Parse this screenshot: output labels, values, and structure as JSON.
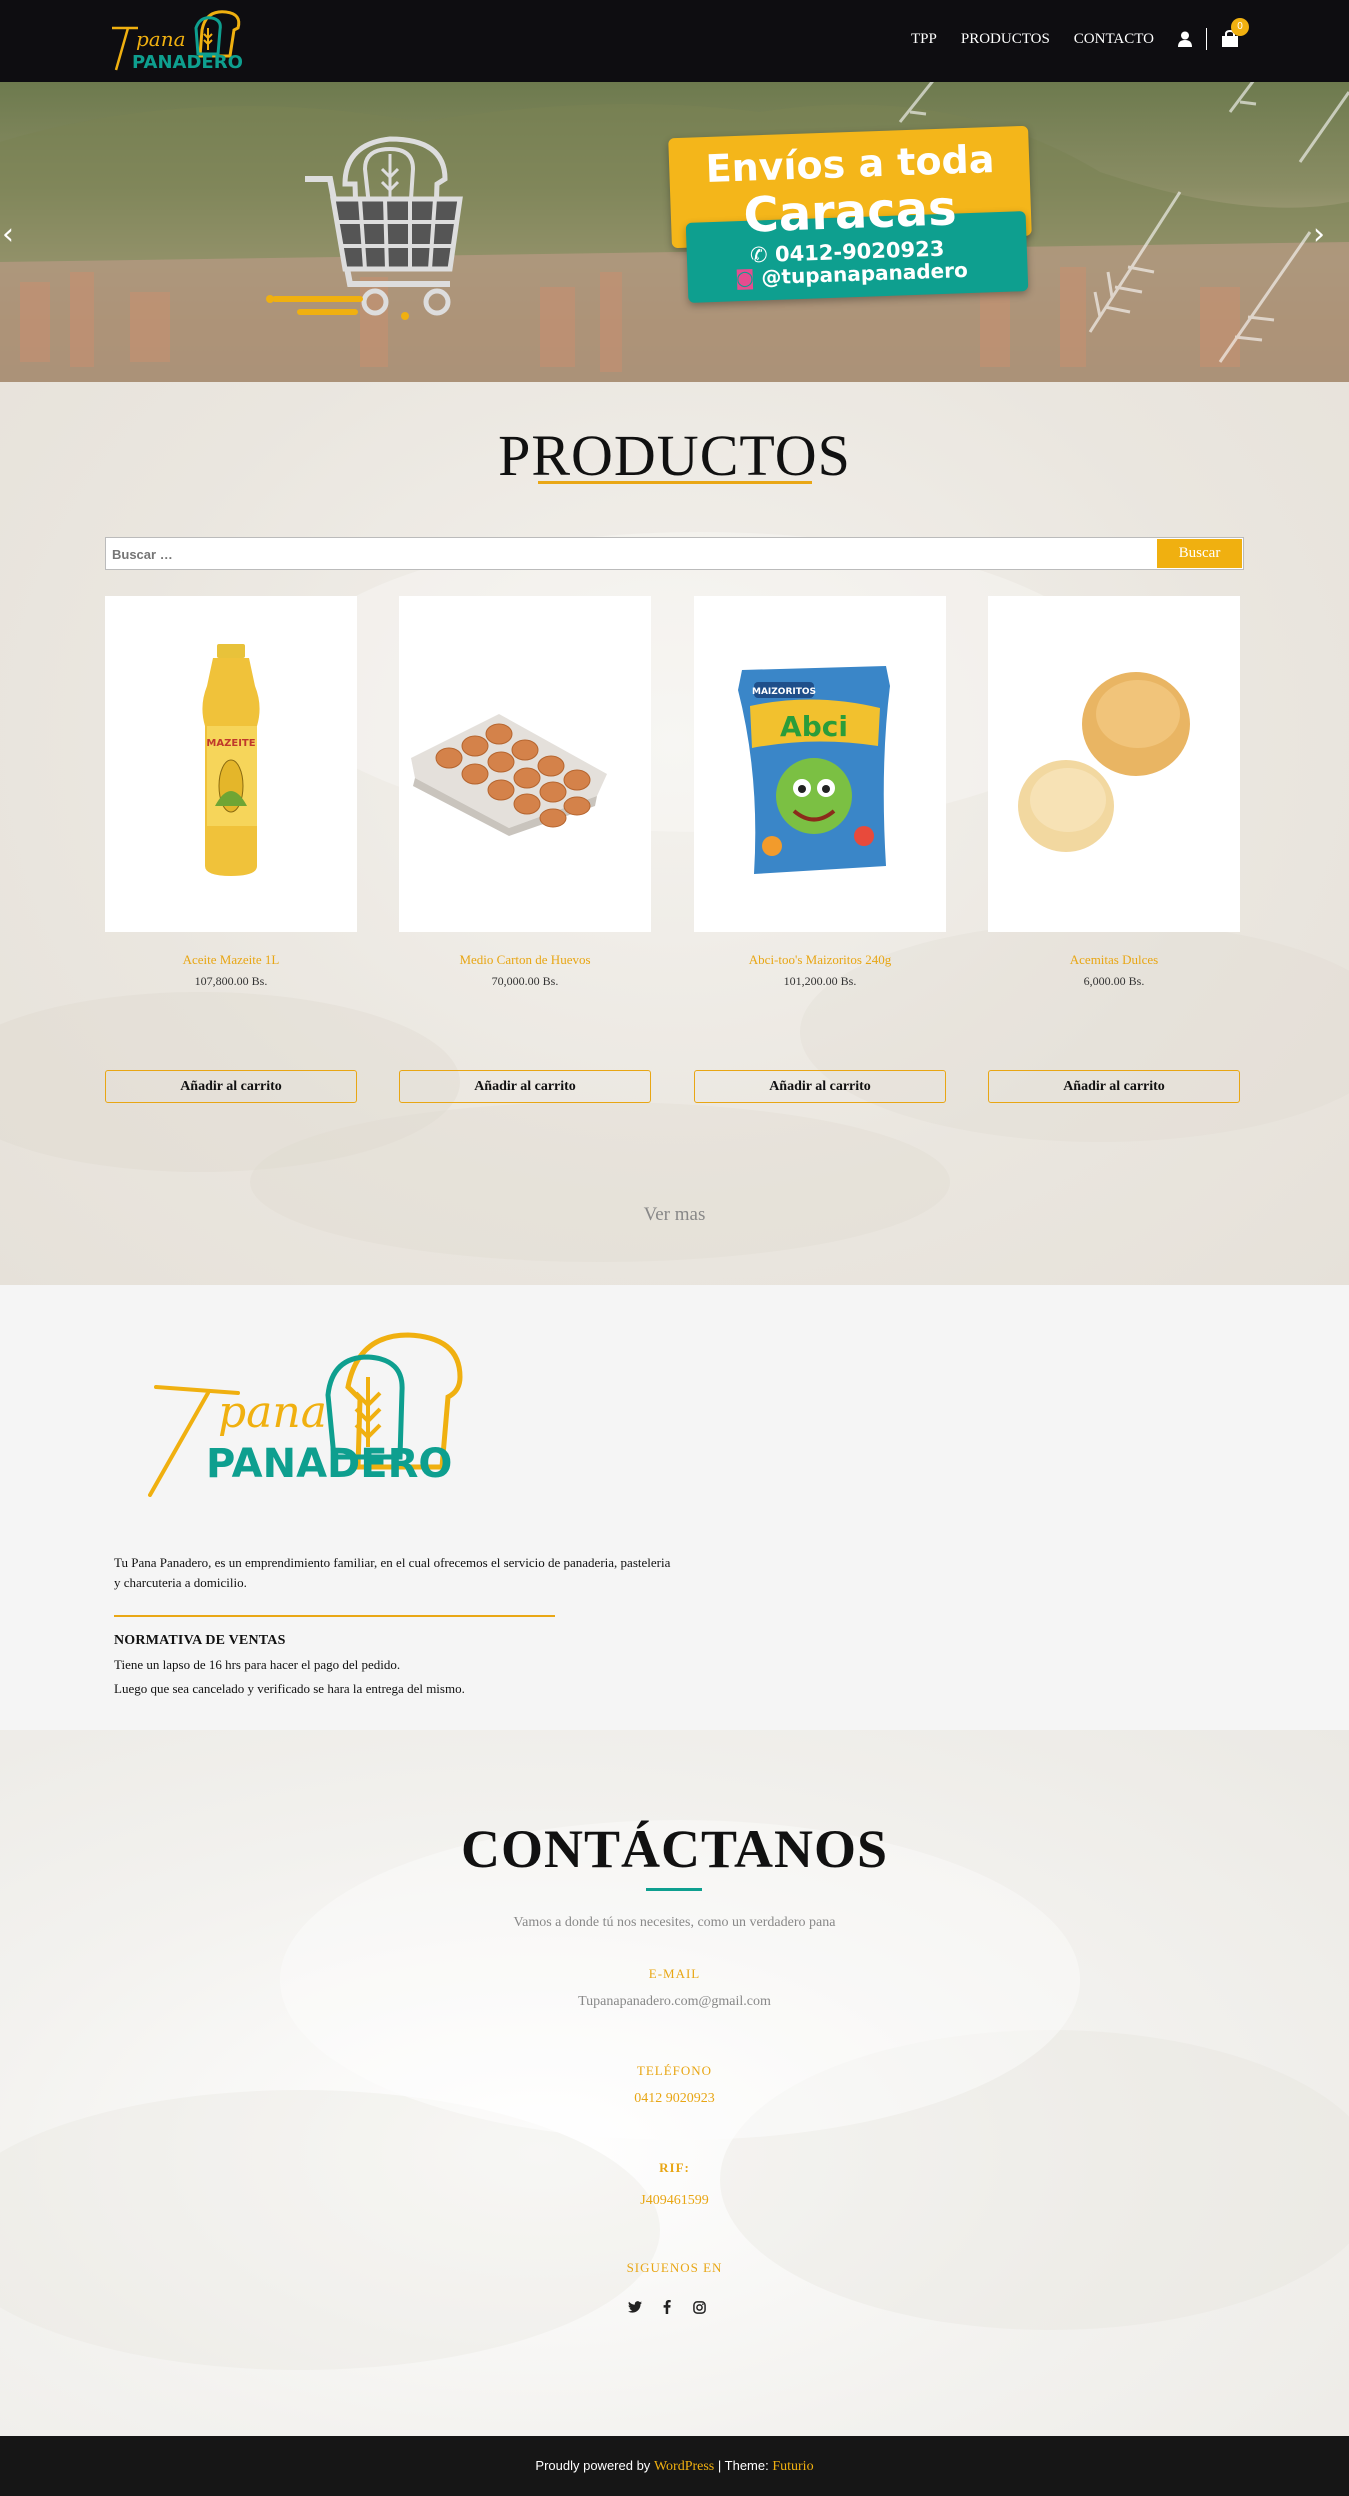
{
  "brand": {
    "logo_top": "Tu pana",
    "logo_bottom": "PANADERO",
    "color_yellow": "#f0b010",
    "color_teal": "#0e9f8f"
  },
  "nav": {
    "items": [
      {
        "label": "TPP"
      },
      {
        "label": "PRODUCTOS"
      },
      {
        "label": "CONTACTO"
      }
    ],
    "account_icon": "user-icon",
    "cart_icon": "shopping-bag-icon",
    "cart_count": "0"
  },
  "hero": {
    "line1": "Envíos a toda",
    "line2": "Caracas",
    "phone": "0412-9020923",
    "instagram": "@tupanapanadero",
    "prev_icon": "chevron-left-icon",
    "next_icon": "chevron-right-icon"
  },
  "products": {
    "title": "PRODUCTOS",
    "search_placeholder": "Buscar …",
    "search_button": "Buscar",
    "items": [
      {
        "name": "Aceite Mazeite 1L",
        "price": "107,800.00 Bs.",
        "button": "Añadir al carrito"
      },
      {
        "name": "Medio Carton de Huevos",
        "price": "70,000.00 Bs.",
        "button": "Añadir al carrito"
      },
      {
        "name": "Abci-too's Maizoritos 240g",
        "price": "101,200.00 Bs.",
        "button": "Añadir al carrito"
      },
      {
        "name": "Acemitas Dulces",
        "price": "6,000.00 Bs.",
        "button": "Añadir al carrito"
      }
    ],
    "view_more": "Ver mas"
  },
  "about": {
    "description": "Tu Pana Panadero, es un emprendimiento familiar, en el cual ofrecemos el servicio de panaderia, pasteleria y charcuteria a domicilio.",
    "policy_title": "NORMATIVA DE VENTAS",
    "policy_line1": "Tiene un lapso de 16 hrs para hacer el pago del pedido.",
    "policy_line2": "Luego que sea cancelado y verificado se hara la entrega del mismo."
  },
  "contact": {
    "title": "CONTÁCTANOS",
    "subtitle": "Vamos a donde tú nos necesites, como un verdadero pana",
    "email_label": "E-MAIL",
    "email": "Tupanapanadero.com@gmail.com",
    "phone_label": "TELÉFONO",
    "phone": "0412 9020923",
    "rif_label": "RIF:",
    "rif": "J409461599",
    "follow_label": "SIGUENOS EN",
    "social_icons": [
      "twitter-icon",
      "facebook-icon",
      "instagram-icon"
    ]
  },
  "footer": {
    "prefix": "Proudly powered by",
    "wp": "WordPress",
    "sep": "| Theme:",
    "theme": "Futurio"
  }
}
